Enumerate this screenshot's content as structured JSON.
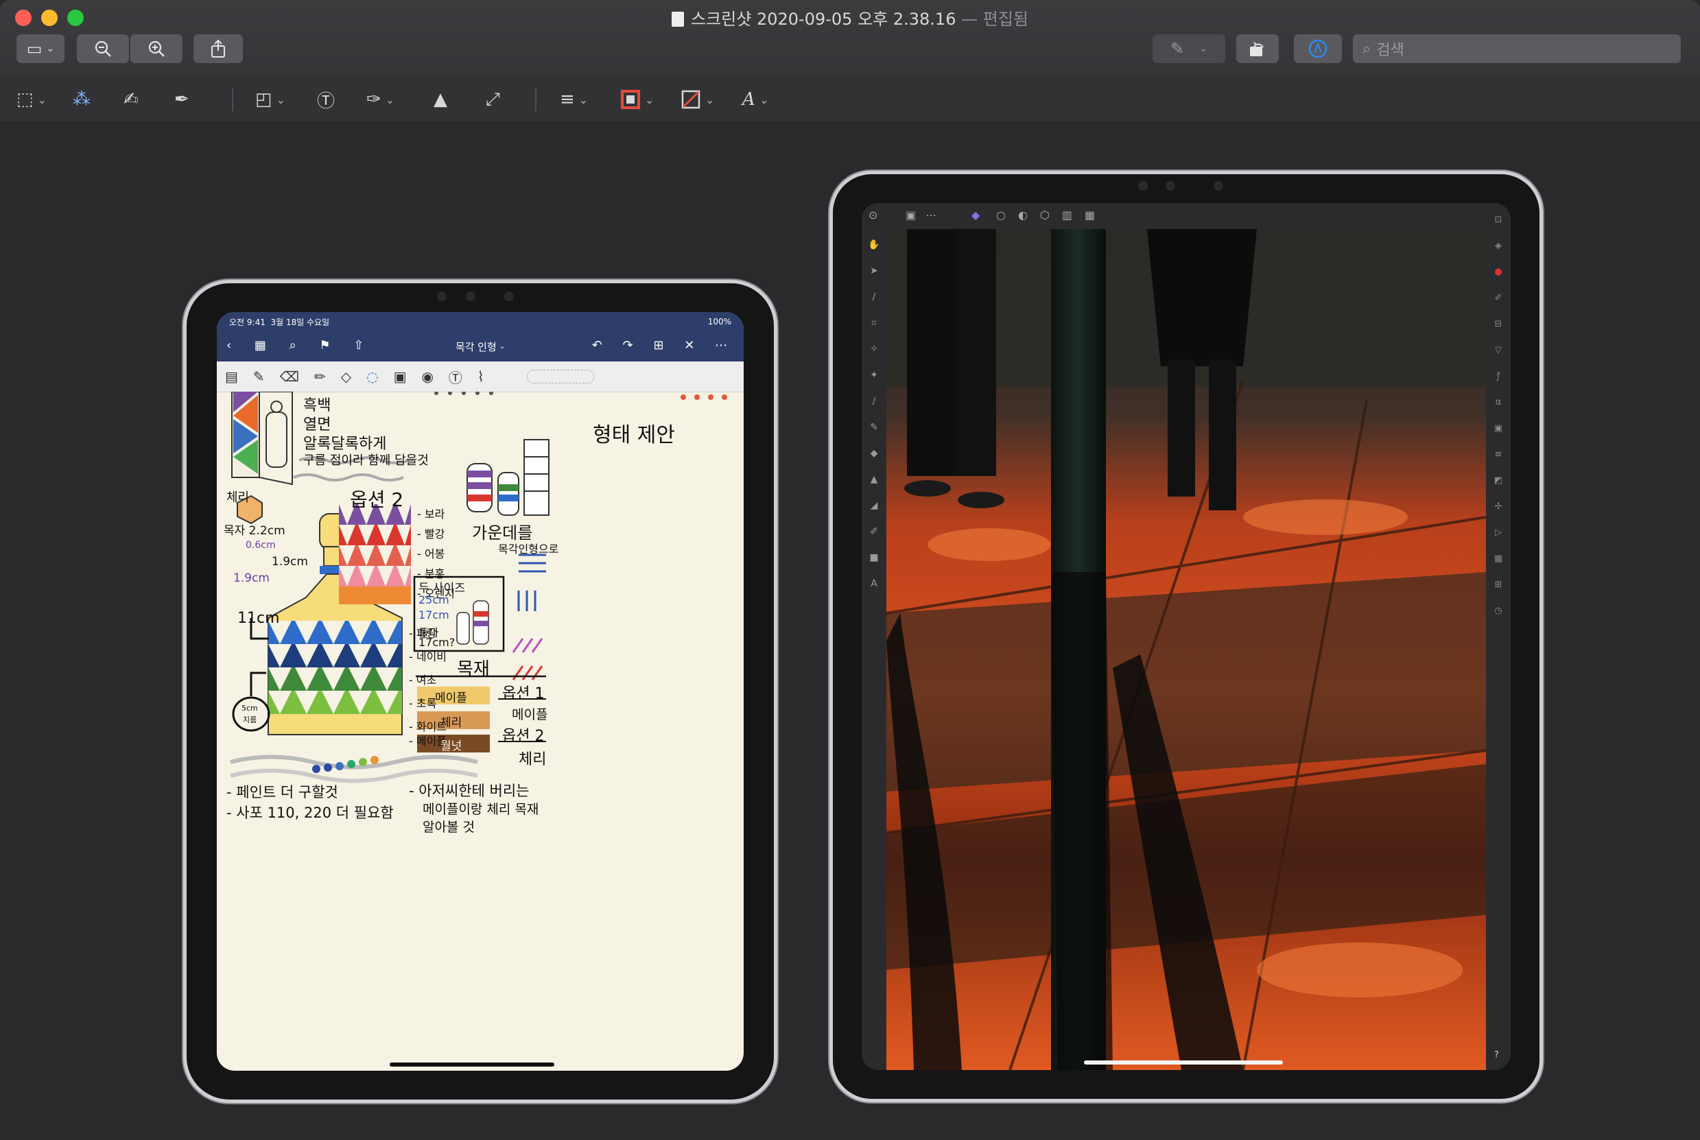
{
  "window": {
    "title": "스크린샷 2020-09-05 오후 2.38.16",
    "title_status": "— 편집됨"
  },
  "toolbar": {
    "sidebar_icon": "sidebar-icon",
    "zoom_out_icon": "zoom-out-icon",
    "zoom_in_icon": "zoom-in-icon",
    "share_icon": "share-icon",
    "markup_icon": "pen-icon",
    "rotate_icon": "rotate-icon",
    "annotate_icon": "markup-circle-icon",
    "search_placeholder": "검색"
  },
  "markup_tools": [
    "rect-select-icon",
    "instant-alpha-icon",
    "sketch-icon",
    "draw-icon",
    "shapes-icon",
    "text-icon",
    "sign-icon",
    "adjust-color-icon",
    "adjust-size-icon",
    "shape-style-icon",
    "border-color-icon",
    "fill-color-icon",
    "text-style-icon"
  ],
  "left_ipad": {
    "status_time": "오전 9:41",
    "status_date": "3월 18일 수요일",
    "status_battery": "100%",
    "doc_title": "목각 인형",
    "notes": {
      "line1": "흑백",
      "line2": "열면",
      "line3": "알록달록하게",
      "line4": "구름 점이라 함께 담을것",
      "heading_right": "형태 제안",
      "cherry_label": "체리",
      "option2_label": "옵션 2",
      "colors_right": [
        "- 보라",
        "- 빨강",
        "- 어봉",
        "- 분홍",
        "- 오렌지"
      ],
      "dim1": "목자 2.2cm",
      "dim2": "0.6cm",
      "dim3": "1.9cm",
      "dim4": "1.9cm",
      "dim5": "11cm",
      "colors_left": [
        "- 파랑",
        "- 네이비",
        "- 여초",
        "- 초록",
        "- 화이트",
        "- 메이플"
      ],
      "center_label": "가운데를",
      "center_sub": "목각인형으로",
      "size_box_title": "두 사이즈",
      "size_a": "25cm",
      "size_b": "17cm",
      "size_c": "둘다",
      "size_d": "17cm?",
      "wood_heading": "목재",
      "wood_swatches": [
        "메이플",
        "체리",
        "월넛"
      ],
      "wood_options": [
        "옵션 1",
        "메이플",
        "옵션 2",
        "체리"
      ],
      "circle_label_top": "5cm",
      "circle_label_bottom": "지름",
      "todo1": "- 페인트 더 구할것",
      "todo2": "- 사포 110, 220 더 필요함",
      "todo3": "- 아저씨한테 버리는",
      "todo4": "메이플이랑 체리 목재",
      "todo5": "알아볼 것"
    },
    "dot_colors": [
      "#2d4aa3",
      "#2d4aa3",
      "#3a72c4",
      "#2aa86a",
      "#7dbb3d",
      "#e89536"
    ]
  },
  "right_ipad": {
    "help_label": "?"
  }
}
